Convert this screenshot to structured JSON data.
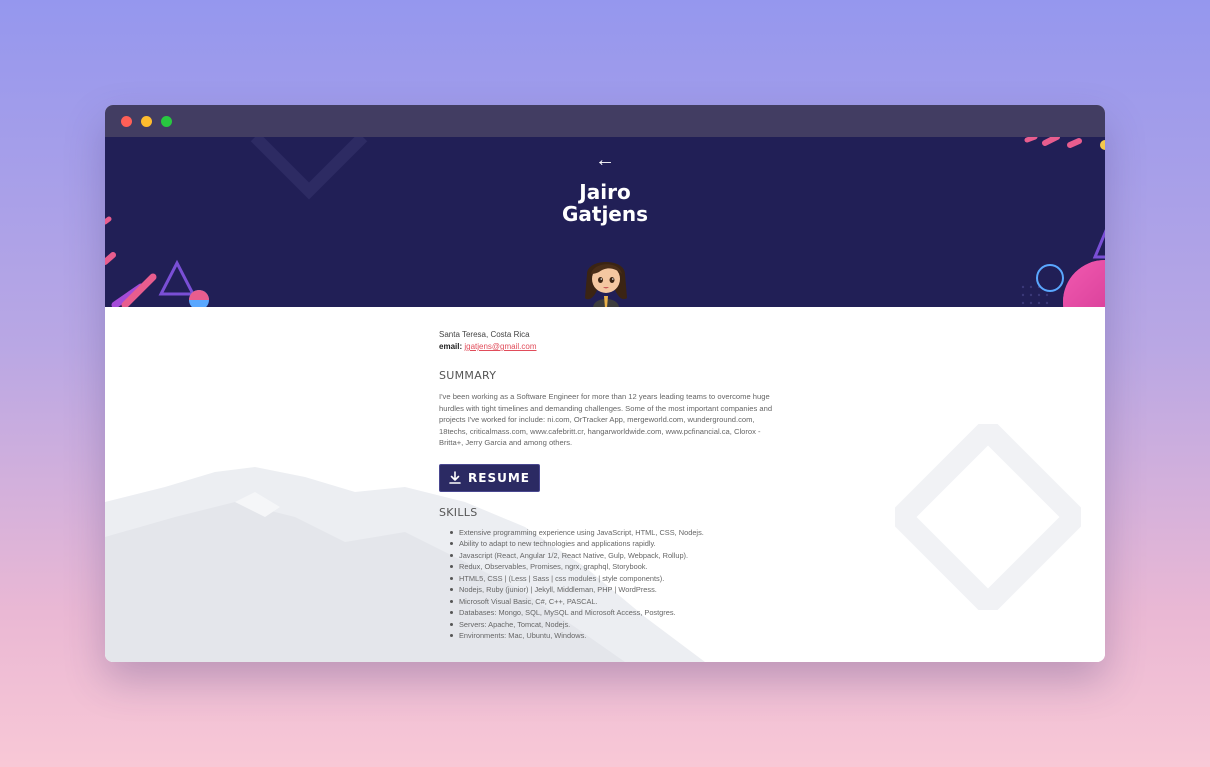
{
  "hero": {
    "back_label": "←",
    "first_name": "Jairo",
    "last_name": "Gatjens"
  },
  "profile": {
    "location": "Santa Teresa, Costa Rica",
    "email_label": "email:",
    "email": "jgatjens@gmail.com"
  },
  "summary": {
    "title": "SUMMARY",
    "text": "I've been working as a Software Engineer for more than 12 years leading teams to overcome huge hurdles with tight timelines and demanding challenges. Some of the most important companies and projects I've worked for include: ni.com, OrTracker App, mergeworld.com, wunderground.com, 18techs, criticalmass.com, www.cafebritt.cr, hangarworldwide.com, www.pcfinancial.ca, Clorox - Britta+, Jerry Garcia and among others."
  },
  "resume_button": {
    "label": "RESUME",
    "icon": "download-icon"
  },
  "skills": {
    "title": "SKILLS",
    "items": [
      "Extensive programming experience using JavaScript, HTML, CSS, Nodejs.",
      "Ability to adapt to new technologies and applications rapidly.",
      "Javascript (React, Angular 1/2, React Native, Gulp, Webpack, Rollup).",
      "Redux, Observables, Promises, ngrx, graphql, Storybook.",
      "HTML5, CSS | (Less | Sass | css modules | style components).",
      "Nodejs, Ruby (junior) | Jekyll, Middleman, PHP | WordPress.",
      "Microsoft Visual Basic, C#, C++, PASCAL.",
      "Databases: Mongo, SQL, MySQL and Microsoft Access, Postgres.",
      "Servers: Apache, Tomcat, Nodejs.",
      "Environments: Mac, Ubuntu, Windows."
    ]
  },
  "colors": {
    "hero_bg": "#211f56",
    "titlebar": "#423d62",
    "button_bg": "#2b2a63",
    "link": "#e14c5a"
  }
}
